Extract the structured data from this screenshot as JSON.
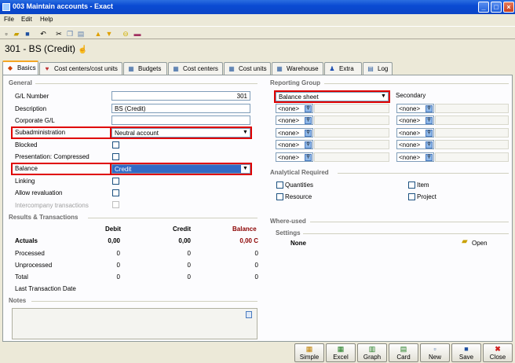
{
  "window": {
    "title": "003 Maintain accounts - Exact"
  },
  "menu": {
    "file": "File",
    "edit": "Edit",
    "help": "Help"
  },
  "record": {
    "title": "301 - BS (Credit)"
  },
  "tabs": [
    {
      "label": "Basics"
    },
    {
      "label": "Cost centers/cost units"
    },
    {
      "label": "Budgets"
    },
    {
      "label": "Cost centers"
    },
    {
      "label": "Cost units"
    },
    {
      "label": "Warehouse"
    },
    {
      "label": "Extra"
    },
    {
      "label": "Log"
    }
  ],
  "general": {
    "heading": "General",
    "gl_number_label": "G/L Number",
    "gl_number_value": "301",
    "description_label": "Description",
    "description_value": "BS (Credit)",
    "corporate_gl_label": "Corporate G/L",
    "corporate_gl_value": "",
    "subadmin_label": "Subadministration",
    "subadmin_value": "Neutral account",
    "blocked_label": "Blocked",
    "presentation_label": "Presentation: Compressed",
    "balance_label": "Balance",
    "balance_value": "Credit",
    "linking_label": "Linking",
    "allow_revaluation_label": "Allow revaluation",
    "intercompany_label": "Intercompany transactions"
  },
  "results": {
    "heading": "Results & Transactions",
    "col_debit": "Debit",
    "col_credit": "Credit",
    "col_balance": "Balance",
    "rows": [
      {
        "label": "Actuals",
        "debit": "0,00",
        "credit": "0,00",
        "balance": "0,00 C"
      },
      {
        "label": "Processed",
        "debit": "0",
        "credit": "0",
        "balance": "0"
      },
      {
        "label": "Unprocessed",
        "debit": "0",
        "credit": "0",
        "balance": "0"
      },
      {
        "label": "Total",
        "debit": "0",
        "credit": "0",
        "balance": "0"
      }
    ],
    "last_transaction_label": "Last Transaction Date"
  },
  "notes": {
    "heading": "Notes"
  },
  "reporting": {
    "heading": "Reporting Group",
    "primary_value": "Balance sheet",
    "secondary_label": "Secondary",
    "none_label": "<none>"
  },
  "analytical": {
    "heading": "Analytical Required",
    "quantities": "Quantities",
    "item": "Item",
    "resource": "Resource",
    "project": "Project"
  },
  "where_used": {
    "heading": "Where-used"
  },
  "settings": {
    "heading": "Settings",
    "value": "None",
    "open_label": "Open"
  },
  "buttons": {
    "simple": "Simple",
    "excel": "Excel",
    "graph": "Graph",
    "card": "Card",
    "new": "New",
    "save": "Save",
    "close": "Close"
  },
  "colors": {
    "title_bar": "#0a4bd3",
    "highlight_outline": "#e00000",
    "selection": "#316ac5",
    "balance_red": "#8b0000"
  }
}
